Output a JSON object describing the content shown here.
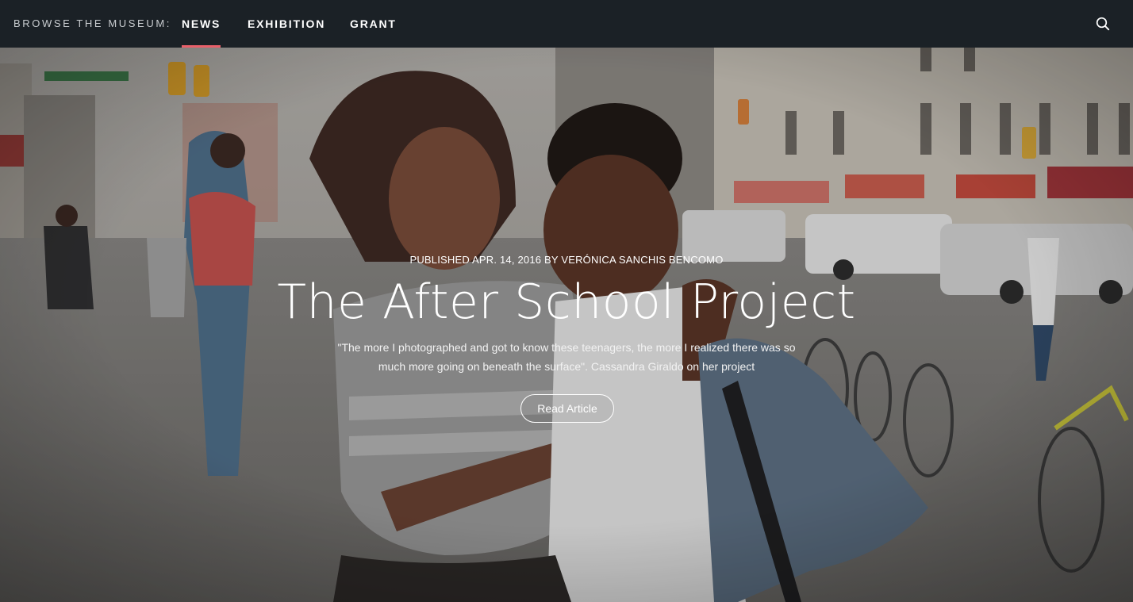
{
  "nav": {
    "browse_label": "BROWSE THE MUSEUM:",
    "items": [
      {
        "label": "NEWS",
        "active": true
      },
      {
        "label": "EXHIBITION",
        "active": false
      },
      {
        "label": "GRANT",
        "active": false
      }
    ],
    "search_icon": "search-icon",
    "active_underline_color": "#e8606a",
    "background_color": "#1b2126"
  },
  "hero": {
    "published": "PUBLISHED APR. 14, 2016 BY VERÓNICA SANCHIS BENCOMO",
    "title": "The After School Project",
    "quote": "\"The more I photographed and got to know these teenagers, the more I realized there was so much more going on beneath the surface\". Cassandra Giraldo on her project",
    "button_label": "Read Article",
    "image_subject": "two teenagers embracing on a city street with bicycles, vans and storefronts in the background"
  }
}
